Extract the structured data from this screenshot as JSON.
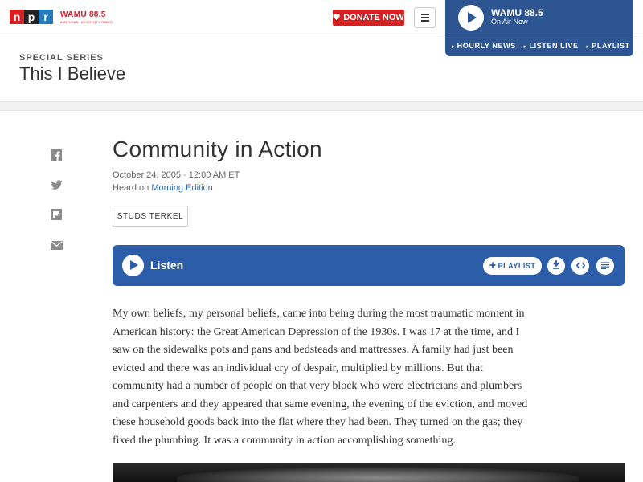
{
  "header": {
    "logo_letters": [
      "n",
      "p",
      "r"
    ],
    "station_logo": "WAMU 88.5",
    "station_tagline": "AMERICAN UNIVERSITY RADIO",
    "donate_label": "DONATE NOW",
    "menu_icon": "hamburger-icon"
  },
  "player": {
    "station": "WAMU 88.5",
    "status": "On Air Now",
    "links": [
      "HOURLY NEWS",
      "LISTEN LIVE",
      "PLAYLIST"
    ]
  },
  "series": {
    "label": "SPECIAL SERIES",
    "title": "This I Believe"
  },
  "share_icons": [
    "facebook-icon",
    "twitter-icon",
    "flipboard-icon",
    "email-icon"
  ],
  "article": {
    "headline": "Community in Action",
    "date": "October 24, 2005 · 12:00 AM ET",
    "heard_on_prefix": "Heard on ",
    "heard_on_program": "Morning Edition",
    "tag": "STUDS TERKEL",
    "audio": {
      "label": "Listen",
      "playlist_label": "PLAYLIST",
      "buttons": [
        "download-icon",
        "embed-icon",
        "transcript-icon"
      ]
    },
    "body": "My own beliefs, my personal beliefs, came into being during the most traumatic moment in American history: the Great American Depression of the 1930s. I was 17 at the time, and I saw on the sidewalks pots and pans and bedsteads and mattresses. A family had just been evicted and there was an individual cry of despair, multiplied by millions. But that community had a number of people on that very block who were electricians and plumbers and carpenters and they appeared that same evening, the evening of the eviction, and moved these household goods back into the flat where they had been. They turned on the gas; they fixed the plumbing. It was a community in action accomplishing something."
  },
  "colors": {
    "npr_red": "#d62021",
    "player_blue": "#2c5591",
    "audio_blue": "#2c5da8",
    "link_blue": "#2f6cad"
  }
}
